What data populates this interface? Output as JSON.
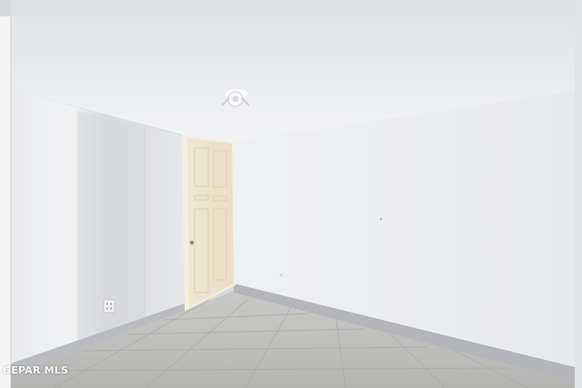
{
  "watermark": {
    "text": "GEPAR MLS"
  },
  "scene": {
    "ceiling_color": "#e9ebee",
    "left_wall_color": "#e6e7e9",
    "back_wall_color": "#eeeff1",
    "door_color": "#efe6cf",
    "door_frame_color": "#f3efe3",
    "baseboard_color": "#b7b9bc",
    "floor_color": "#bcbcba",
    "floor_grout_color": "#a9a9a7",
    "ceiling_fixture_icon": "ceiling-light-icon",
    "door_knob_icon": "door-knob-icon",
    "outlet_icon": "wall-outlet-icon"
  }
}
